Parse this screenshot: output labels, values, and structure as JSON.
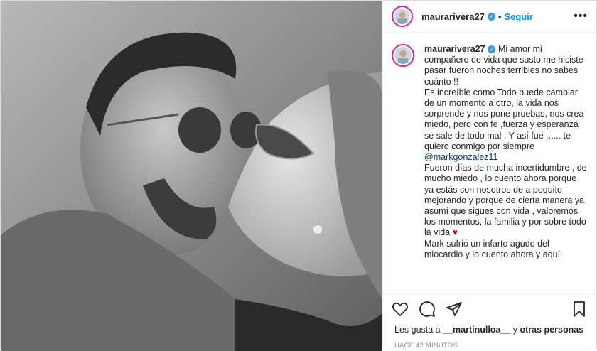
{
  "post": {
    "username": "maurarivera27",
    "separator": "•",
    "follow_label": "Seguir",
    "more_label": "•••",
    "caption": {
      "username": "maurarivera27",
      "text_part1": "Mi amor mi compañero de vida que susto me hiciste pasar fueron noches terribles no sabes cuánto !!\nEs increíble como Todo puede cambiar de un momento a otro, la vida nos sorprende y nos pone pruebas, nos crea miedo, pero con fe ,fuerza y esperanza se sale de todo mal , Y así fue ...... te quiero conmigo por siempre ",
      "mention": "@markgonzalez11",
      "text_part2": "\nFueron días de mucha incertidumbre , de mucho miedo , lo cuento ahora porque ya estás con nosotros de a poquito mejorando y porque de cierta manera ya asumí que sigues con vida , valoremos los momentos, la familia y por sobre todo la vida ",
      "heart": "♥",
      "text_part3": "\nMark sufrió un infarto agudo del miocardio y lo cuento ahora y aquí"
    },
    "likes": {
      "prefix": "Les gusta a ",
      "user": "__martinulloa__",
      "middle": " y ",
      "others": "otras personas"
    },
    "timestamp": "HACE 42 MINUTOS",
    "icons": [
      "heart-outline-icon",
      "comment-icon",
      "share-icon",
      "bookmark-icon"
    ],
    "colors": {
      "follow": "#0095f6",
      "verified": "#3897f0",
      "ring": "#d6249f",
      "heart": "#c0102e"
    }
  }
}
